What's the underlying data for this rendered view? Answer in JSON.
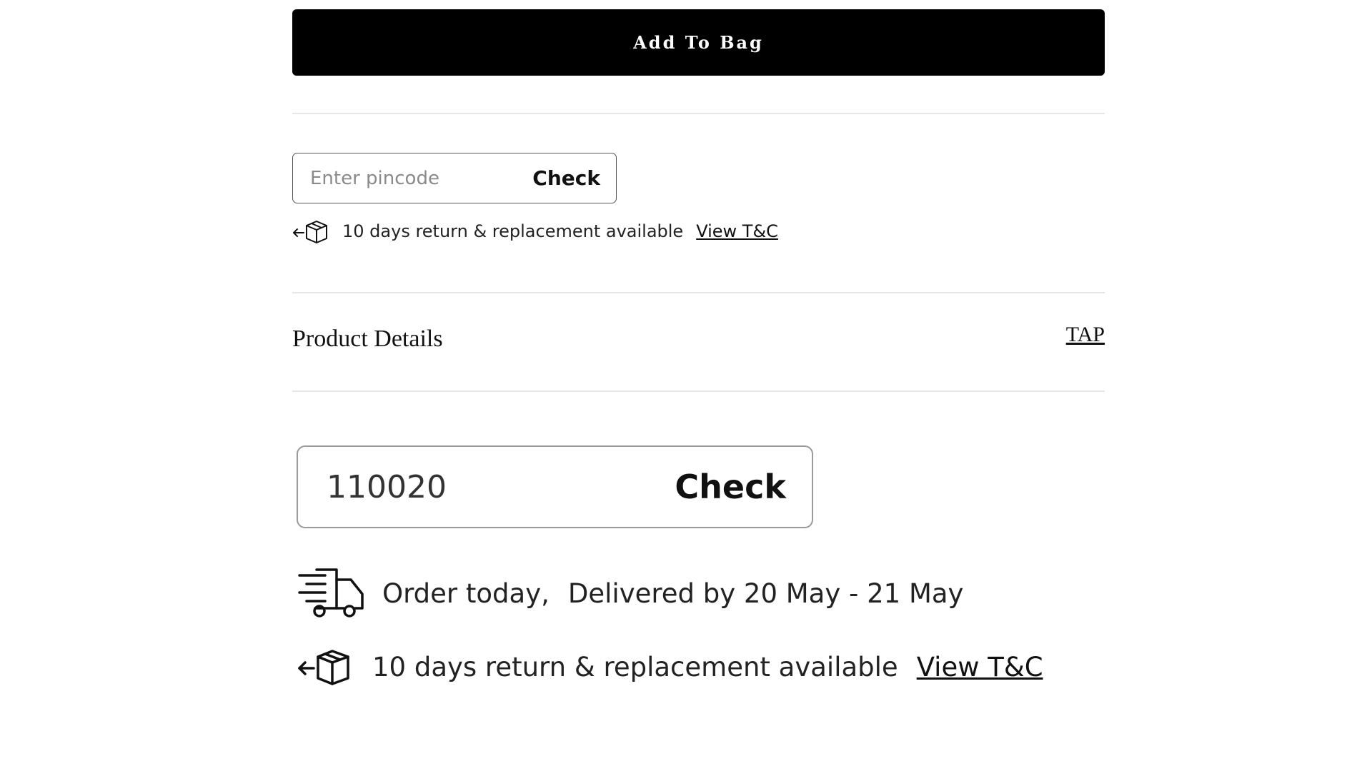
{
  "add_to_bag": {
    "label": "Add To Bag"
  },
  "pincode_small": {
    "placeholder": "Enter pincode",
    "check_label": "Check",
    "return_text": "10 days return & replacement available",
    "return_link": "View T&C",
    "return_icon": "return-box-icon"
  },
  "product_details": {
    "title": "Product Details",
    "toggle": "TAP"
  },
  "pincode_large": {
    "value": "110020",
    "check_label": "Check",
    "delivery_prefix": "Order today,",
    "delivery_text": "Delivered by 20 May - 21 May",
    "delivery_icon": "delivery-truck-icon",
    "return_text": "10 days return & replacement available",
    "return_link": "View T&C",
    "return_icon": "return-box-icon"
  },
  "colors": {
    "primary_button": "#000000",
    "divider": "#e6e6e6",
    "text": "#111111"
  }
}
